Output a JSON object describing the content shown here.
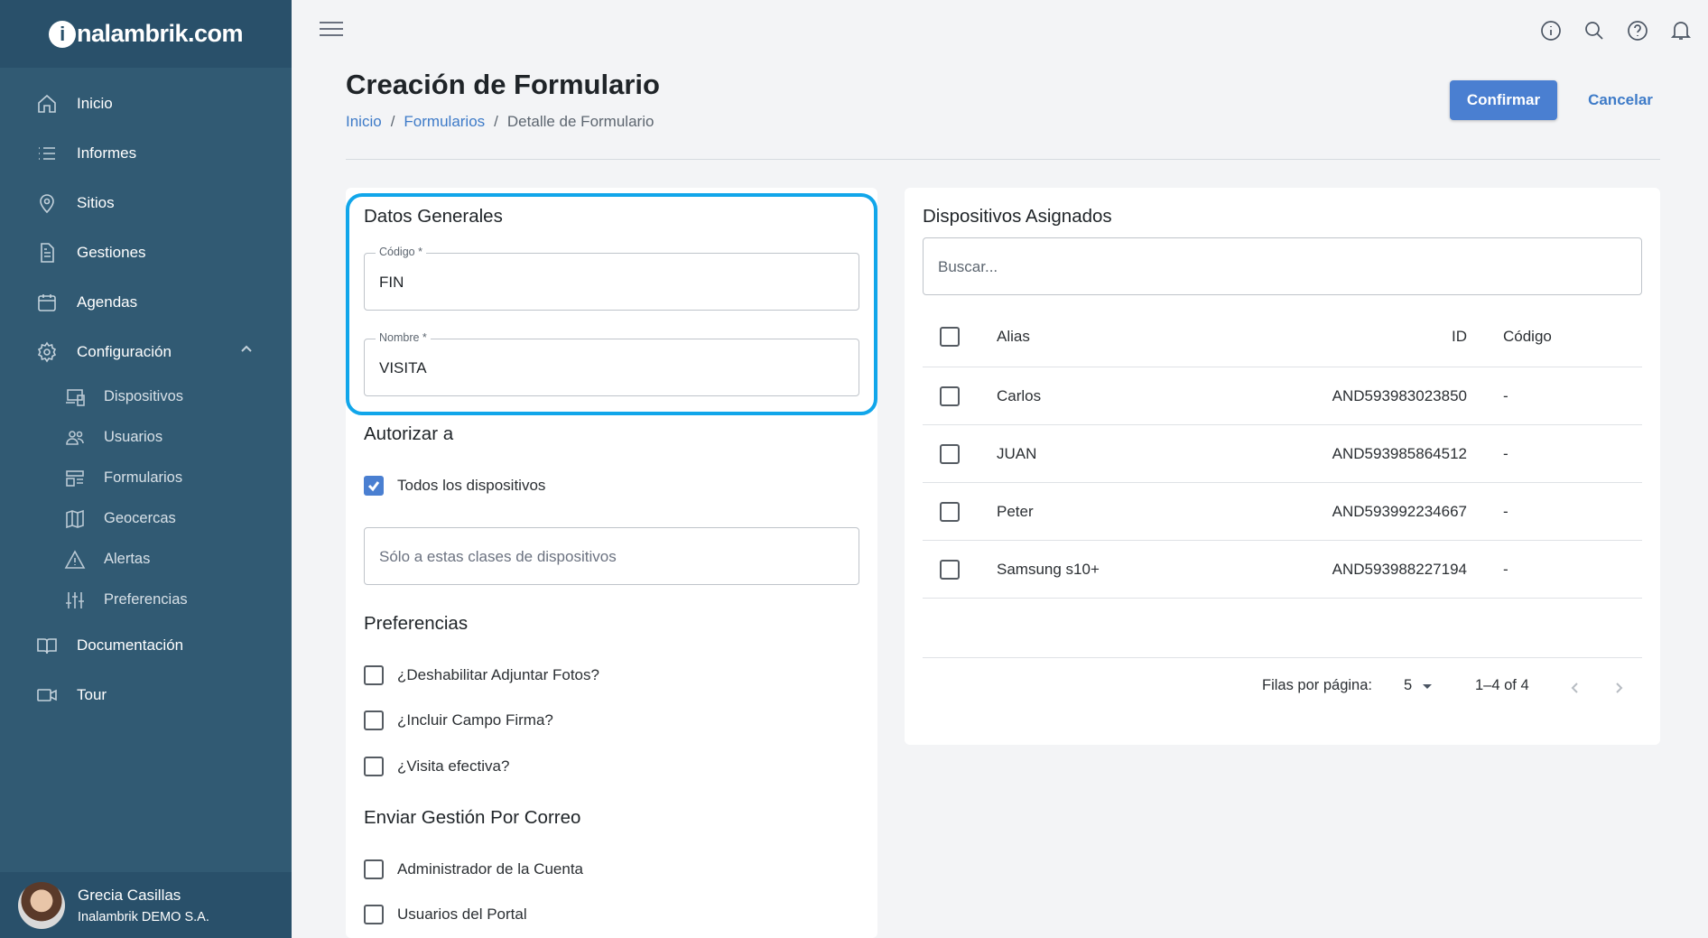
{
  "brand": {
    "logo_prefix": "i",
    "logo_text": "nalambrik.com"
  },
  "sidebar": {
    "items": [
      {
        "label": "Inicio",
        "icon": "home-icon"
      },
      {
        "label": "Informes",
        "icon": "list-icon"
      },
      {
        "label": "Sitios",
        "icon": "map-pin-icon"
      },
      {
        "label": "Gestiones",
        "icon": "document-icon"
      },
      {
        "label": "Agendas",
        "icon": "calendar-icon"
      },
      {
        "label": "Configuración",
        "icon": "gear-icon",
        "expanded": true
      }
    ],
    "sub_items": [
      {
        "label": "Dispositivos",
        "icon": "devices-icon"
      },
      {
        "label": "Usuarios",
        "icon": "users-icon"
      },
      {
        "label": "Formularios",
        "icon": "forms-icon"
      },
      {
        "label": "Geocercas",
        "icon": "map-icon"
      },
      {
        "label": "Alertas",
        "icon": "warning-icon"
      },
      {
        "label": "Preferencias",
        "icon": "sliders-icon"
      }
    ],
    "bottom_items": [
      {
        "label": "Documentación",
        "icon": "book-icon"
      },
      {
        "label": "Tour",
        "icon": "video-icon"
      }
    ],
    "user": {
      "name": "Grecia Casillas",
      "org": "Inalambrik DEMO S.A."
    }
  },
  "header": {
    "title": "Creación de Formulario",
    "breadcrumb": [
      "Inicio",
      "Formularios",
      "Detalle de Formulario"
    ],
    "confirm_label": "Confirmar",
    "cancel_label": "Cancelar"
  },
  "general": {
    "title": "Datos Generales",
    "codigo_label": "Código *",
    "codigo_value": "FIN",
    "nombre_label": "Nombre *",
    "nombre_value": "VISITA"
  },
  "authorize": {
    "title": "Autorizar a",
    "all_devices_label": "Todos los dispositivos",
    "all_devices_checked": true,
    "classes_placeholder": "Sólo a estas clases de dispositivos"
  },
  "preferences": {
    "title": "Preferencias",
    "options": [
      {
        "label": "¿Deshabilitar Adjuntar Fotos?",
        "checked": false
      },
      {
        "label": "¿Incluir Campo Firma?",
        "checked": false
      },
      {
        "label": "¿Visita efectiva?",
        "checked": false
      }
    ]
  },
  "email": {
    "title": "Enviar Gestión Por Correo",
    "options": [
      {
        "label": "Administrador de la Cuenta",
        "checked": false
      },
      {
        "label": "Usuarios del Portal",
        "checked": false
      }
    ]
  },
  "devices": {
    "title": "Dispositivos Asignados",
    "search_placeholder": "Buscar...",
    "columns": [
      "Alias",
      "ID",
      "Código"
    ],
    "rows": [
      {
        "alias": "Carlos",
        "id": "AND593983023850",
        "code": "-"
      },
      {
        "alias": "JUAN",
        "id": "AND593985864512",
        "code": "-"
      },
      {
        "alias": "Peter",
        "id": "AND593992234667",
        "code": "-"
      },
      {
        "alias": "Samsung s10+",
        "id": "AND593988227194",
        "code": "-"
      }
    ],
    "pagination": {
      "rows_label": "Filas por página:",
      "rows_value": "5",
      "range": "1–4 of 4"
    }
  },
  "colors": {
    "sidebar": "#315a73",
    "accent": "#4a7fd1",
    "highlight": "#11a6ea"
  }
}
